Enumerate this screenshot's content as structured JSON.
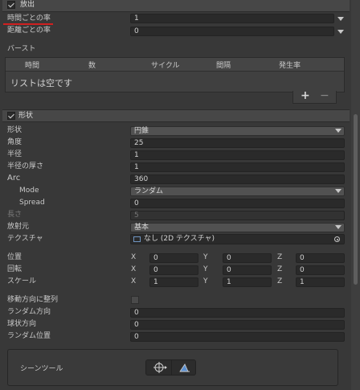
{
  "emission": {
    "title": "放出",
    "rate_over_time_label": "時間ごとの率",
    "rate_over_time_value": "1",
    "rate_over_distance_label": "距離ごとの率",
    "rate_over_distance_value": "0",
    "burst_label": "バースト",
    "burst_columns": [
      "時間",
      "数",
      "サイクル",
      "間隔",
      "発生率"
    ],
    "burst_empty": "リストは空です",
    "add_symbol": "+",
    "remove_symbol": "−"
  },
  "shape": {
    "title": "形状",
    "shape_label": "形状",
    "shape_value": "円錐",
    "angle_label": "角度",
    "angle_value": "25",
    "radius_label": "半径",
    "radius_value": "1",
    "radius_thickness_label": "半径の厚さ",
    "radius_thickness_value": "1",
    "arc_label": "Arc",
    "arc_value": "360",
    "mode_label": "Mode",
    "mode_value": "ランダム",
    "spread_label": "Spread",
    "spread_value": "0",
    "length_label": "長さ",
    "length_value": "5",
    "emit_from_label": "放射元",
    "emit_from_value": "基本",
    "texture_label": "テクスチャ",
    "texture_value": "なし (2D テクスチャ)",
    "position_label": "位置",
    "position": {
      "x": "0",
      "y": "0",
      "z": "0"
    },
    "rotation_label": "回転",
    "rotation": {
      "x": "0",
      "y": "0",
      "z": "0"
    },
    "scale_label": "スケール",
    "scale": {
      "x": "1",
      "y": "1",
      "z": "1"
    },
    "axis_x": "X",
    "axis_y": "Y",
    "axis_z": "Z",
    "align_label": "移動方向に整列",
    "random_dir_label": "ランダム方向",
    "random_dir_value": "0",
    "spherize_label": "球状方向",
    "spherize_value": "0",
    "random_pos_label": "ランダム位置",
    "random_pos_value": "0",
    "scene_tools_label": "シーンツール"
  },
  "colors": {
    "underline": "#d02020"
  }
}
